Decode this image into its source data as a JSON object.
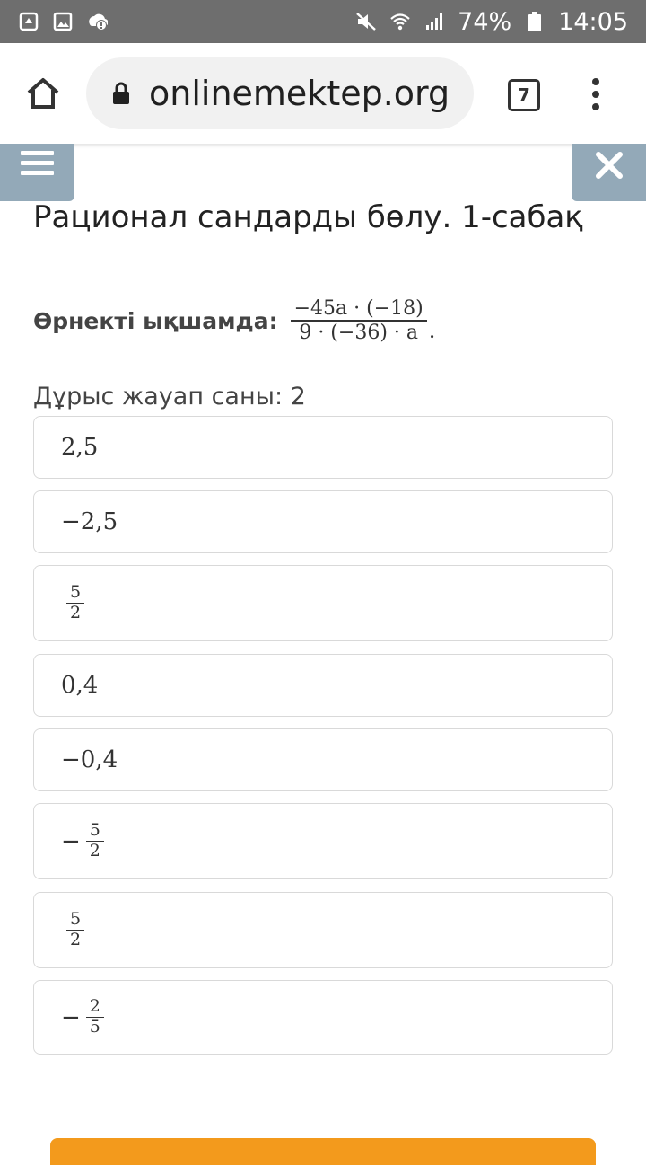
{
  "status_bar": {
    "battery_percent": "74%",
    "time": "14:05"
  },
  "browser": {
    "url": "onlinemektep.org",
    "tab_count": "7"
  },
  "page": {
    "title": "Рационал сандарды бөлу. 1-сабақ",
    "question_label": "Өрнекті ықшамда:",
    "expression": {
      "numerator": "−45a · (−18)",
      "denominator": "9 · (−36) · a"
    },
    "question_end": ".",
    "answer_count_text": "Дұрыс жауап саны: 2",
    "options": [
      {
        "text": "2,5"
      },
      {
        "text": "−2,5"
      },
      {
        "sign": "",
        "numerator": "5",
        "denominator": "2"
      },
      {
        "text": "0,4"
      },
      {
        "text": "−0,4"
      },
      {
        "sign": "−",
        "numerator": "5",
        "denominator": "2"
      },
      {
        "sign": "",
        "numerator": "5",
        "denominator": "2"
      },
      {
        "sign": "−",
        "numerator": "2",
        "denominator": "5"
      }
    ]
  },
  "icons": {
    "status_left": [
      "recycle-icon",
      "image-icon",
      "sync-alert-icon"
    ],
    "status_right": [
      "mute-icon",
      "wifi-icon",
      "signal-icon",
      "battery-icon"
    ],
    "browser": [
      "home-icon",
      "lock-icon",
      "tab-switcher-icon",
      "more-vert-icon"
    ],
    "page": [
      "hamburger-menu-icon",
      "close-icon"
    ]
  },
  "colors": {
    "status_bar": "#6e6e6e",
    "page_buttons": "#93a9b8",
    "submit_button": "#f39a1c",
    "option_border": "#d9d9d9"
  }
}
